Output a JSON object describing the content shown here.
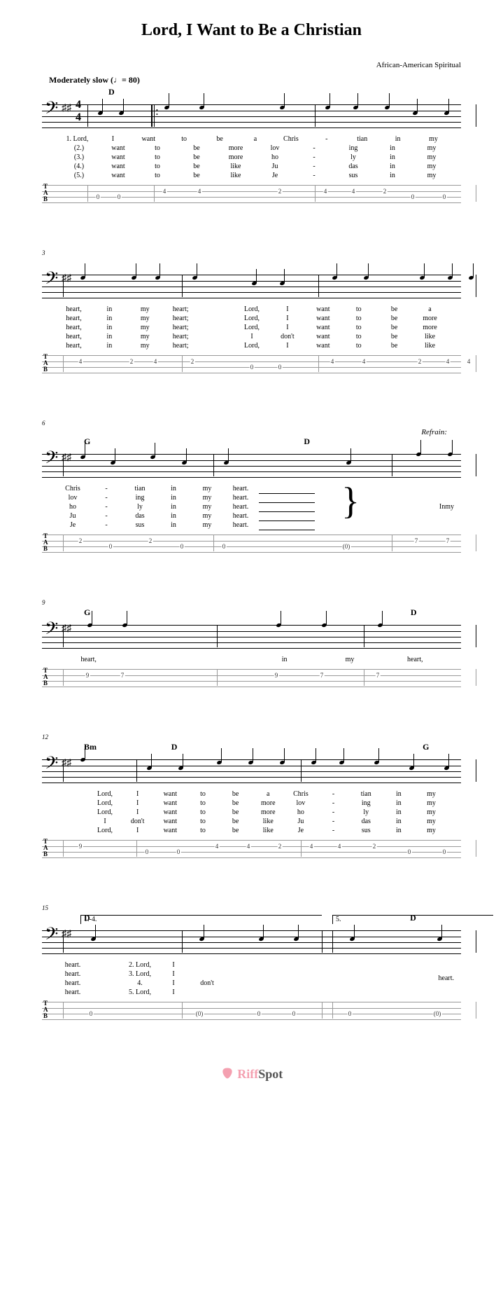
{
  "title": "Lord, I Want to Be a Christian",
  "attribution": "African-American Spiritual",
  "tempo_label": "Moderately slow",
  "tempo_bpm": "80",
  "time_signature": {
    "top": "4",
    "bottom": "4"
  },
  "refrain_label": "Refrain:",
  "ending_labels": {
    "first": "1.-4.",
    "second": "5."
  },
  "watermark": {
    "brand": "RiffSpot"
  },
  "tab_label": [
    "T",
    "A",
    "B"
  ],
  "chart_data": {
    "type": "music-score",
    "clef": "bass",
    "key": "D major (2 sharps)",
    "time": "4/4",
    "tempo_bpm": 80,
    "systems": [
      {
        "measure_start": 1,
        "chords": [
          {
            "beat": 0,
            "name": "D"
          }
        ],
        "lyrics": [
          [
            "1. Lord,",
            "I",
            "want",
            "to",
            "be",
            "a",
            "Chris",
            "-",
            "tian",
            "in",
            "my"
          ],
          [
            "(2.)",
            "want",
            "to",
            "be",
            "more",
            "lov",
            "-",
            "ing",
            "in",
            "my"
          ],
          [
            "(3.)",
            "want",
            "to",
            "be",
            "more",
            "ho",
            "-",
            "ly",
            "in",
            "my"
          ],
          [
            "(4.)",
            "want",
            "to",
            "be",
            "like",
            "Ju",
            "-",
            "das",
            "in",
            "my"
          ],
          [
            "(5.)",
            "want",
            "to",
            "be",
            "like",
            "Je",
            "-",
            "sus",
            "in",
            "my"
          ]
        ],
        "tab": [
          {
            "string": 3,
            "fret": 0,
            "pos": 80
          },
          {
            "string": 3,
            "fret": 0,
            "pos": 110
          },
          {
            "string": 2,
            "fret": 4,
            "pos": 175
          },
          {
            "string": 2,
            "fret": 4,
            "pos": 225
          },
          {
            "string": 2,
            "fret": 2,
            "pos": 340
          },
          {
            "string": 2,
            "fret": 4,
            "pos": 405
          },
          {
            "string": 2,
            "fret": 4,
            "pos": 445
          },
          {
            "string": 2,
            "fret": 2,
            "pos": 490
          },
          {
            "string": 3,
            "fret": 0,
            "pos": 530
          },
          {
            "string": 3,
            "fret": 0,
            "pos": 575
          }
        ],
        "barlines": [
          65,
          160,
          390,
          620
        ]
      },
      {
        "measure_start": 3,
        "chords": [],
        "lyrics": [
          [
            "heart,",
            "in",
            "my",
            "heart;",
            "",
            "Lord,",
            "I",
            "want",
            "to",
            "be",
            "a"
          ],
          [
            "heart,",
            "in",
            "my",
            "heart;",
            "",
            "Lord,",
            "I",
            "want",
            "to",
            "be",
            "more"
          ],
          [
            "heart,",
            "in",
            "my",
            "heart;",
            "",
            "Lord,",
            "I",
            "want",
            "to",
            "be",
            "more"
          ],
          [
            "heart,",
            "in",
            "my",
            "heart;",
            "",
            "I",
            "don't",
            "want",
            "to",
            "be",
            "like"
          ],
          [
            "heart,",
            "in",
            "my",
            "heart;",
            "",
            "Lord,",
            "I",
            "want",
            "to",
            "be",
            "like"
          ]
        ],
        "tab": [
          {
            "string": 2,
            "fret": 4,
            "pos": 55
          },
          {
            "string": 2,
            "fret": 2,
            "pos": 128
          },
          {
            "string": 2,
            "fret": 4,
            "pos": 162
          },
          {
            "string": 2,
            "fret": 2,
            "pos": 215
          },
          {
            "string": 3,
            "fret": 0,
            "pos": 300
          },
          {
            "string": 3,
            "fret": 0,
            "pos": 340
          },
          {
            "string": 2,
            "fret": 4,
            "pos": 415
          },
          {
            "string": 2,
            "fret": 4,
            "pos": 460
          },
          {
            "string": 2,
            "fret": 2,
            "pos": 540
          },
          {
            "string": 2,
            "fret": 4,
            "pos": 580
          },
          {
            "string": 2,
            "fret": 4,
            "pos": 610
          }
        ],
        "barlines": [
          30,
          200,
          395,
          620
        ]
      },
      {
        "measure_start": 6,
        "chords": [
          {
            "beat": 0,
            "name": "G"
          },
          {
            "beat": 2,
            "name": "D"
          }
        ],
        "refrain_at": 2,
        "lyrics_left": [
          [
            "Chris",
            "-",
            "tian",
            "in",
            "my",
            "heart."
          ],
          [
            "lov",
            "-",
            "ing",
            "in",
            "my",
            "heart."
          ],
          [
            "ho",
            "-",
            "ly",
            "in",
            "my",
            "heart."
          ],
          [
            "Ju",
            "-",
            "das",
            "in",
            "my",
            "heart."
          ],
          [
            "Je",
            "-",
            "sus",
            "in",
            "my",
            "heart."
          ]
        ],
        "lyrics_right": [
          [
            "In",
            "my"
          ]
        ],
        "tab": [
          {
            "string": 2,
            "fret": 2,
            "pos": 55
          },
          {
            "string": 3,
            "fret": 0,
            "pos": 98
          },
          {
            "string": 2,
            "fret": 2,
            "pos": 155
          },
          {
            "string": 3,
            "fret": 0,
            "pos": 200
          },
          {
            "string": 3,
            "fret": 0,
            "pos": 260
          },
          {
            "string": 3,
            "fret": 0,
            "pos": 435,
            "paren": true
          },
          {
            "string": 2,
            "fret": 7,
            "pos": 535
          },
          {
            "string": 2,
            "fret": 7,
            "pos": 580
          }
        ],
        "barlines": [
          30,
          245,
          500,
          620
        ]
      },
      {
        "measure_start": 9,
        "chords": [
          {
            "beat": 0,
            "name": "G"
          },
          {
            "beat": 3,
            "name": "D"
          }
        ],
        "lyrics": [
          [
            "heart,",
            "",
            "",
            "in",
            "my",
            "heart,"
          ]
        ],
        "tab": [
          {
            "string": 2,
            "fret": 9,
            "pos": 65
          },
          {
            "string": 2,
            "fret": 7,
            "pos": 115
          },
          {
            "string": 2,
            "fret": 9,
            "pos": 335
          },
          {
            "string": 2,
            "fret": 7,
            "pos": 400
          },
          {
            "string": 2,
            "fret": 7,
            "pos": 480
          }
        ],
        "barlines": [
          30,
          250,
          460,
          620
        ]
      },
      {
        "measure_start": 12,
        "chords": [
          {
            "beat": 0,
            "name": "Bm"
          },
          {
            "beat": 0.7,
            "name": "D"
          },
          {
            "beat": 3,
            "name": "G"
          }
        ],
        "lyrics": [
          [
            "",
            "Lord,",
            "I",
            "want",
            "to",
            "be",
            "a",
            "Chris",
            "-",
            "tian",
            "in",
            "my"
          ],
          [
            "",
            "Lord,",
            "I",
            "want",
            "to",
            "be",
            "more",
            "lov",
            "-",
            "ing",
            "in",
            "my"
          ],
          [
            "",
            "Lord,",
            "I",
            "want",
            "to",
            "be",
            "more",
            "ho",
            "-",
            "ly",
            "in",
            "my"
          ],
          [
            "",
            "I",
            "don't",
            "want",
            "to",
            "be",
            "like",
            "Ju",
            "-",
            "das",
            "in",
            "my"
          ],
          [
            "",
            "Lord,",
            "I",
            "want",
            "to",
            "be",
            "like",
            "Je",
            "-",
            "sus",
            "in",
            "my"
          ]
        ],
        "tab": [
          {
            "string": 2,
            "fret": 9,
            "pos": 55
          },
          {
            "string": 3,
            "fret": 0,
            "pos": 150
          },
          {
            "string": 3,
            "fret": 0,
            "pos": 195
          },
          {
            "string": 2,
            "fret": 4,
            "pos": 250
          },
          {
            "string": 2,
            "fret": 4,
            "pos": 295
          },
          {
            "string": 2,
            "fret": 2,
            "pos": 340
          },
          {
            "string": 2,
            "fret": 4,
            "pos": 385
          },
          {
            "string": 2,
            "fret": 4,
            "pos": 425
          },
          {
            "string": 2,
            "fret": 2,
            "pos": 475
          },
          {
            "string": 3,
            "fret": 0,
            "pos": 525
          },
          {
            "string": 3,
            "fret": 0,
            "pos": 575
          }
        ],
        "barlines": [
          30,
          135,
          370,
          620
        ]
      },
      {
        "measure_start": 15,
        "chords": [
          {
            "beat": 0,
            "name": "D"
          },
          {
            "beat": 3,
            "name": "D"
          }
        ],
        "endings": {
          "first_start": 55,
          "second_start": 415
        },
        "lyrics_left": [
          [
            "heart.",
            "",
            "2. Lord,",
            "I"
          ],
          [
            "heart.",
            "",
            "3. Lord,",
            "I"
          ],
          [
            "heart.",
            "",
            "4.",
            "I",
            "don't"
          ],
          [
            "heart.",
            "",
            "5. Lord,",
            "I"
          ]
        ],
        "lyrics_right": [
          [
            "heart."
          ]
        ],
        "tab": [
          {
            "string": 3,
            "fret": 0,
            "pos": 70
          },
          {
            "string": 3,
            "fret": 0,
            "pos": 225,
            "paren": true
          },
          {
            "string": 3,
            "fret": 0,
            "pos": 310
          },
          {
            "string": 3,
            "fret": 0,
            "pos": 360
          },
          {
            "string": 3,
            "fret": 0,
            "pos": 440
          },
          {
            "string": 3,
            "fret": 0,
            "pos": 565,
            "paren": true
          }
        ],
        "barlines": [
          30,
          200,
          400,
          415,
          620
        ]
      }
    ]
  }
}
